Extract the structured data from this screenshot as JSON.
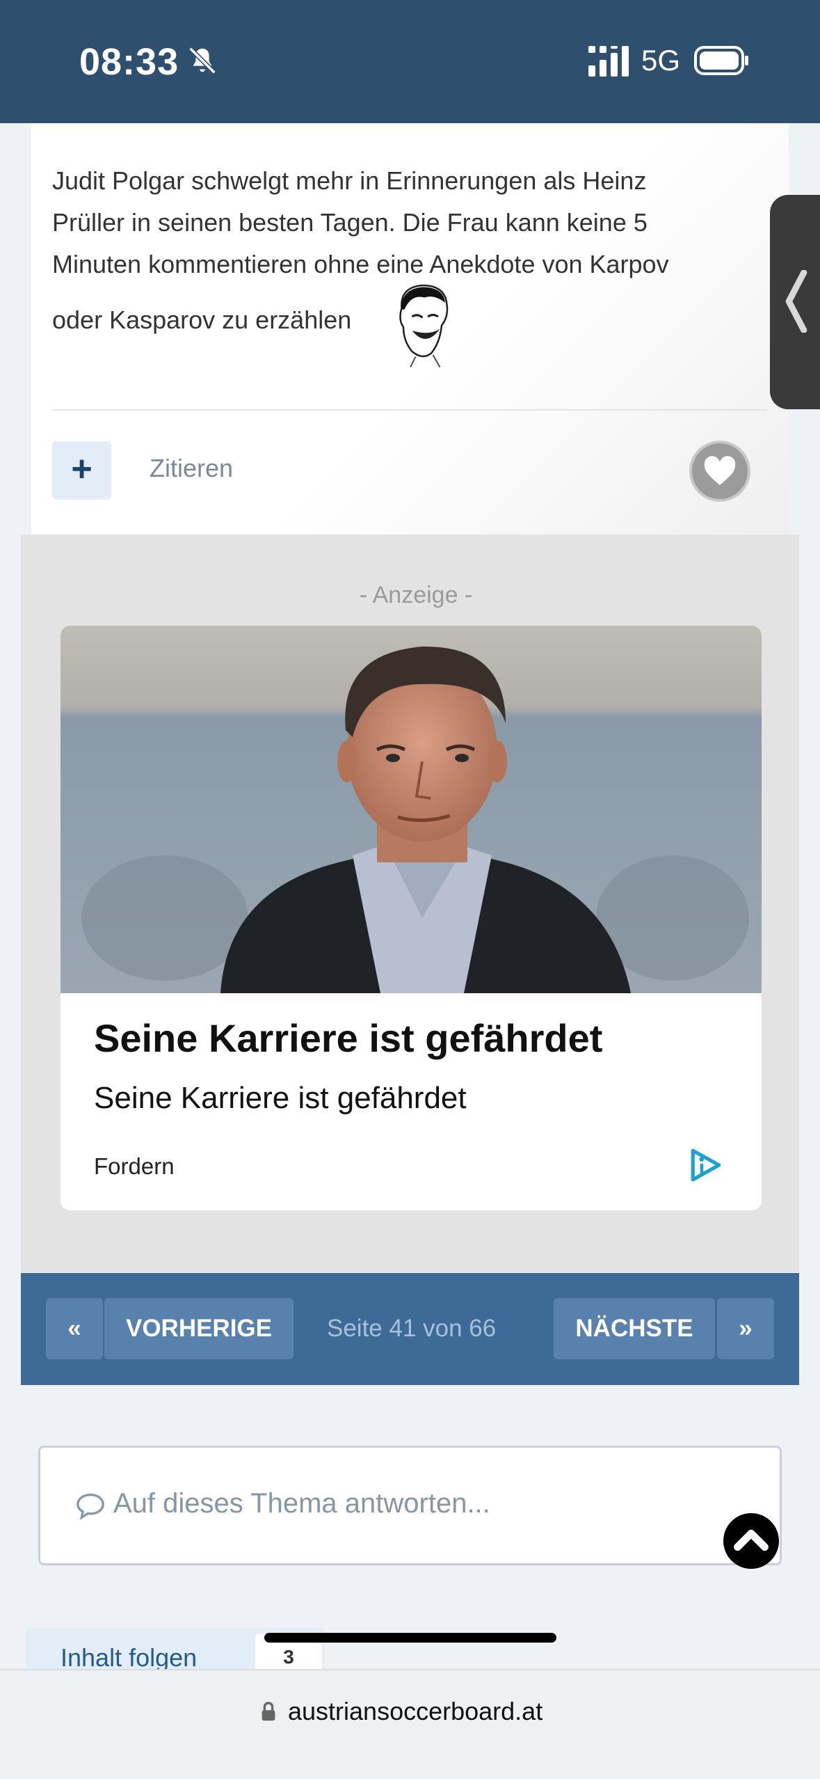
{
  "status_bar": {
    "time": "08:33",
    "network": "5G"
  },
  "post": {
    "text_lines": [
      "Judit Polgar schwelgt mehr in Erinnerungen als Heinz",
      "Prüller in seinen besten Tagen. Die Frau kann keine 5",
      "Minuten kommentieren ohne eine Anekdote von Karpov",
      "oder Kasparov zu erzählen"
    ],
    "plus_label": "+",
    "quote_label": "Zitieren"
  },
  "ad": {
    "label": "- Anzeige -",
    "headline": "Seine Karriere ist gefährdet",
    "subline": "Seine Karriere ist gefährdet",
    "source": "Fordern"
  },
  "pagination": {
    "prev_arrow": "«",
    "prev_label": "VORHERIGE",
    "page_info": "Seite 41 von 66",
    "next_label": "NÄCHSTE",
    "next_arrow": "»"
  },
  "reply": {
    "placeholder": "Auf dieses Thema antworten..."
  },
  "follow": {
    "label": "Inhalt folgen",
    "count": "3"
  },
  "browser": {
    "url": "austriansoccerboard.at"
  },
  "colors": {
    "header_blue": "#2f4f6e",
    "pagination_blue": "#3d6a97",
    "link_blue": "#245b8f"
  }
}
